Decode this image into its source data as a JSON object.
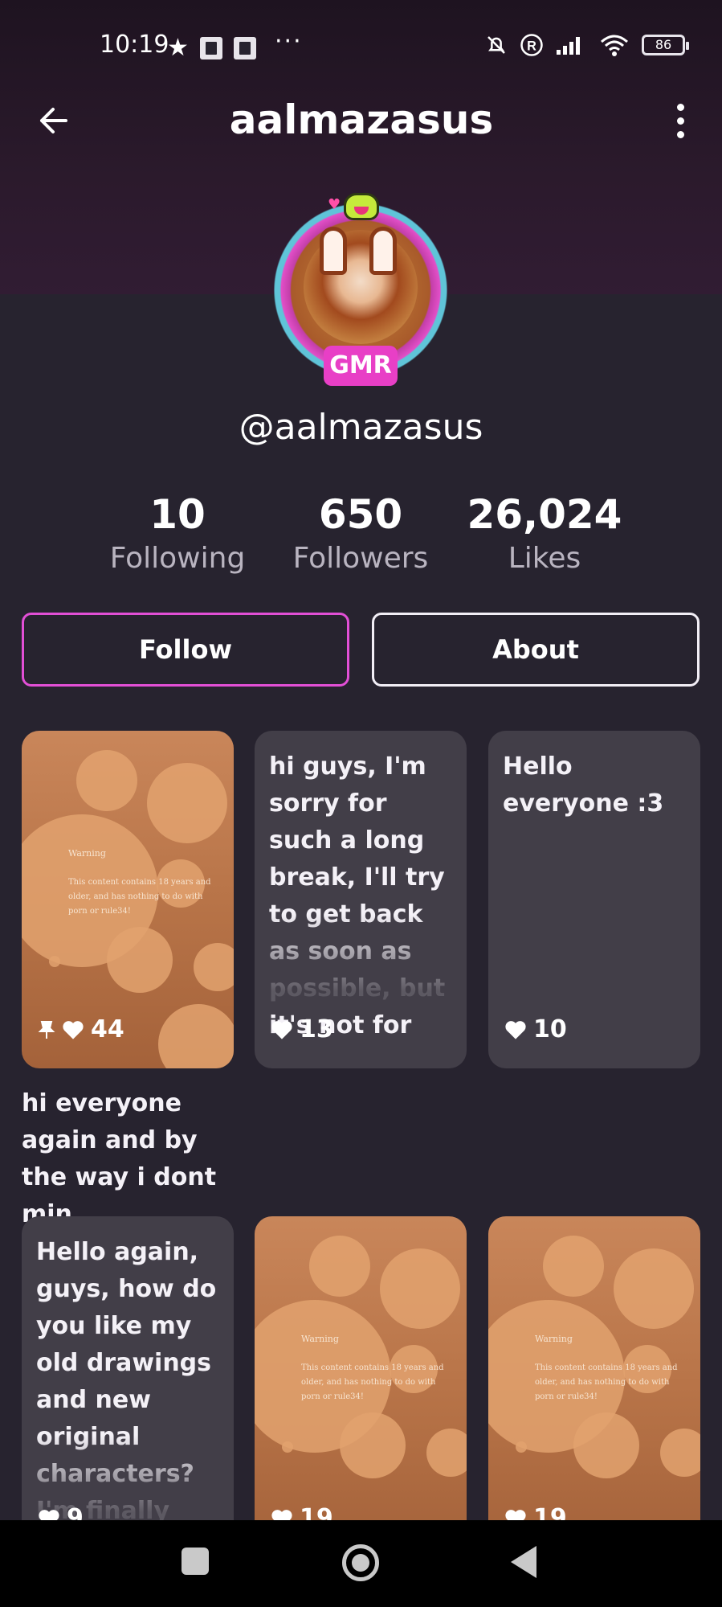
{
  "status_bar": {
    "time": "10:19",
    "dots": "···",
    "battery": "86"
  },
  "header": {
    "title": "aalmazasus"
  },
  "profile": {
    "badge": "GMR",
    "handle": "@aalmazasus"
  },
  "stats": [
    {
      "value": "10",
      "label": "Following"
    },
    {
      "value": "650",
      "label": "Followers"
    },
    {
      "value": "26,024",
      "label": "Likes"
    }
  ],
  "actions": {
    "follow_label": "Follow",
    "about_label": "About"
  },
  "warning": {
    "title": "Warning",
    "body": "This content contains 18 years and older, and has nothing to do with porn or rule34!"
  },
  "posts": [
    {
      "type": "image",
      "likes": "44",
      "pinned": true,
      "caption": "hi everyone again and by the way i dont min..."
    },
    {
      "type": "text",
      "text": "hi guys, I'm sorry for such a long break, I'll try to get back as soon as possible, but it's not for",
      "likes": "13"
    },
    {
      "type": "text",
      "text": "Hello everyone :3",
      "likes": "10"
    },
    {
      "type": "text",
      "text": "Hello again, guys, how do you like my old drawings and new original characters? I'm finally",
      "likes": "9"
    },
    {
      "type": "image",
      "likes": "19"
    },
    {
      "type": "image",
      "likes": "19"
    }
  ]
}
